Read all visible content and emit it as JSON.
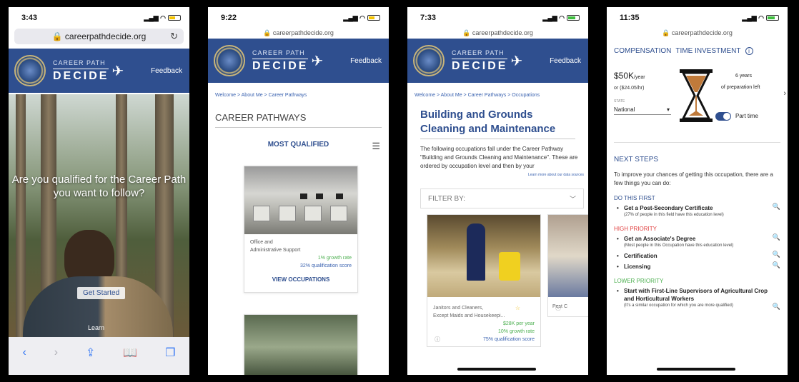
{
  "phones": [
    {
      "time": "3:43",
      "url": "careerpathdecide.org",
      "hero_text": "Are you qualified for the Career Path you want to follow?",
      "cta": "Get Started",
      "learn": "Learn"
    },
    {
      "time": "9:22",
      "url": "careerpathdecide.org",
      "breadcrumb": "Welcome > About Me > Career Pathways",
      "title": "CAREER PATHWAYS",
      "sort": "MOST QUALIFIED",
      "card": {
        "line1": "Office and",
        "line2": "Administrative Support",
        "growth": "1% growth rate",
        "score": "32% qualification score",
        "action": "VIEW OCCUPATIONS"
      }
    },
    {
      "time": "7:33",
      "url": "careerpathdecide.org",
      "breadcrumb": "Welcome > About Me > Career Pathways > Occupations",
      "title": "Building and Grounds Cleaning and Maintenance",
      "desc": "The following occupations fall under the Career Pathway \"Building and Grounds Cleaning and Maintenance\". These are ordered by occupation level and then by your",
      "learn_more": "Learn more about our data sources",
      "filter": "FILTER BY:",
      "occ": {
        "line1": "Janitors and Cleaners,",
        "line2": "Except Maids and Housekeepi...",
        "pay": "$28K per year",
        "growth": "10% growth rate",
        "score": "75% qualification score"
      },
      "next_occ": "Pest C"
    },
    {
      "time": "11:35",
      "url": "careerpathdecide.org",
      "tab_comp": "COMPENSATION",
      "tab_time": "TIME INVESTMENT",
      "salary": "$50K",
      "per": "/year",
      "hourly": "or ($24.05/hr)",
      "state_label": "STATE",
      "state": "National",
      "years": "6 years",
      "years_sub": "of preparation left",
      "part_time": "Part time",
      "next_steps": "NEXT STEPS",
      "intro": "To improve your chances of getting this occupation, there are a few things you can do:",
      "do_first": "DO THIS FIRST",
      "s1": "Get a Post-Secondary Certificate",
      "s1n": "(27% of people in this field have this education level)",
      "high": "HIGH PRIORITY",
      "s2": "Get an Associate's Degree",
      "s2n": "(Most people in this Occupation have this education level)",
      "s3": "Certification",
      "s4": "Licensing",
      "lower": "LOWER PRIORITY",
      "s5": "Start with First-Line Supervisors of Agricultural Crop and Horticultural Workers",
      "s5n": "(It's a similar occupation for which you are more qualified)"
    }
  ],
  "brand": {
    "top": "CAREER PATH",
    "bottom": "DECIDE",
    "feedback": "Feedback",
    "color": "#2f4f8f"
  }
}
